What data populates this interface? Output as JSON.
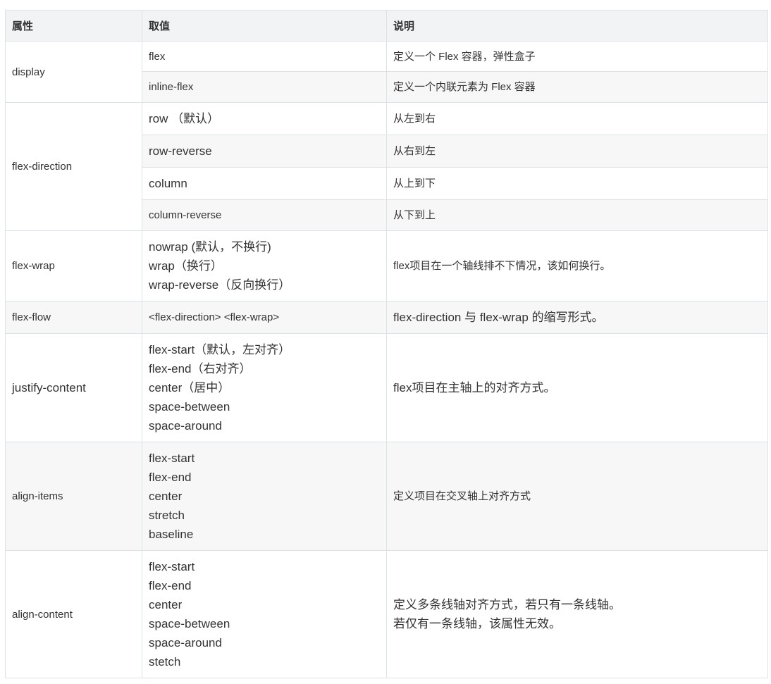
{
  "header": {
    "col1": "属性",
    "col2": "取值",
    "col3": "说明"
  },
  "rows": {
    "display": {
      "property": "display",
      "values": [
        {
          "value": "flex",
          "desc": "定义一个 Flex 容器，弹性盒子"
        },
        {
          "value": "inline-flex",
          "desc": "定义一个内联元素为 Flex 容器"
        }
      ]
    },
    "flex_direction": {
      "property": "flex-direction",
      "values": [
        {
          "value": "row （默认）",
          "desc": "从左到右"
        },
        {
          "value": "row-reverse",
          "desc": "从右到左"
        },
        {
          "value": "column",
          "desc": "从上到下"
        },
        {
          "value": "column-reverse",
          "desc": "从下到上"
        }
      ]
    },
    "flex_wrap": {
      "property": "flex-wrap",
      "values": [
        "nowrap (默认，不换行)",
        "wrap（换行）",
        "wrap-reverse（反向换行）"
      ],
      "desc": "flex项目在一个轴线排不下情况，该如何换行。"
    },
    "flex_flow": {
      "property": "flex-flow",
      "value": "<flex-direction> <flex-wrap>",
      "desc": " flex-direction 与 flex-wrap 的缩写形式。"
    },
    "justify_content": {
      "property": "justify-content",
      "values": [
        "flex-start（默认，左对齐）",
        "flex-end（右对齐）",
        "center（居中）",
        "space-between",
        "space-around"
      ],
      "desc": "flex项目在主轴上的对齐方式。"
    },
    "align_items": {
      "property": "align-items",
      "values": [
        "flex-start",
        "flex-end",
        "center",
        "stretch",
        "baseline"
      ],
      "desc": "定义项目在交叉轴上对齐方式"
    },
    "align_content": {
      "property": "align-content",
      "values": [
        "flex-start",
        "flex-end",
        "center",
        "space-between",
        "space-around",
        "stetch"
      ],
      "desc": [
        "定义多条线轴对齐方式，若只有一条线轴。",
        "若仅有一条线轴，该属性无效。"
      ]
    }
  }
}
